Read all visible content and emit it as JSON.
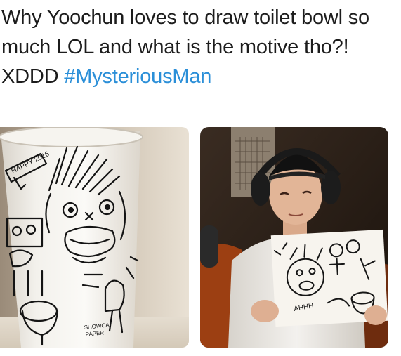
{
  "tweet": {
    "text": "Why Yoochun loves to draw toilet bowl so much LOL and what is the motive tho?! XDDD ",
    "hashtag": "#MysteriousMan",
    "hashtag_color": "#2b8fd8",
    "text_color": "#1c1c1c"
  },
  "media": [
    {
      "description_name": "photo-cup-drawing",
      "cup_labels": {
        "top": "HAPPY 2016",
        "bottom_line1": "SHOWCA",
        "bottom_line2": "PAPER"
      }
    },
    {
      "description_name": "photo-person-holding-drawing",
      "board_label": "AHHH"
    }
  ]
}
